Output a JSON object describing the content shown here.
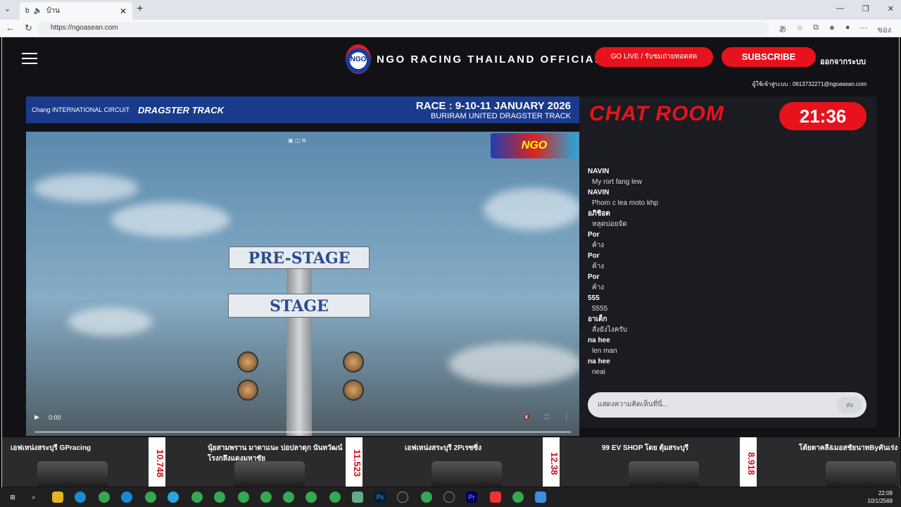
{
  "browser": {
    "tab_title": "บ้าน",
    "url": "https://ngoasean.com",
    "profile_label": "ของ"
  },
  "header": {
    "brand_title": "NGO RACING THAILAND OFFICIAL",
    "logo_text": "NGO",
    "go_live_label": "GO LIVE / รับชมถ่ายทอดสด",
    "subscribe_label": "SUBSCRIBE",
    "logout_label": "ออกจากระบบ",
    "contact": "ผู้ใช้เข้าสู่ระบบ : 0613732271@ngoasean.com"
  },
  "video": {
    "banner_left": "Chang INTERNATIONAL CIRCUIT",
    "banner_track": "DRAGSTER TRACK",
    "race_title": "RACE : 9-10-11 JANUARY 2026",
    "race_subtitle": "BURIRAM UNITED DRAGSTER TRACK",
    "sign_top": "PRE-STAGE",
    "sign_bottom": "STAGE",
    "badge_text": "NGO",
    "time": "0:00"
  },
  "chat": {
    "title": "CHAT ROOM",
    "timer": "21:36",
    "messages": [
      {
        "name": "NAVIN",
        "text": "My rort fang lew"
      },
      {
        "name": "NAVIN",
        "text": "Phom c lea moto khp"
      },
      {
        "name": "อภิชิอต",
        "text": "หลุดบ่อยจัด"
      },
      {
        "name": "Por",
        "text": "ค้าง"
      },
      {
        "name": "Por",
        "text": "ค้าง"
      },
      {
        "name": "Por",
        "text": "ค้าง"
      },
      {
        "name": "555",
        "text": "5555"
      },
      {
        "name": "อาเต็ก",
        "text": "สั่งยังไงครับ"
      },
      {
        "name": "na hee",
        "text": "len man"
      },
      {
        "name": "na hee",
        "text": "neai"
      }
    ],
    "input_placeholder": "แสดงความคิดเห็นที่นี่...",
    "send_label": "ส่ง"
  },
  "ticker": [
    {
      "name": "เอฟเหน่งสระบุรี GPracing",
      "time": "10.748"
    },
    {
      "name": "นุ้ยสามพราน มาดาแนะ บ่อปลาดุก นันทวัฒน์ โรงกลึงแดงมหาชัย",
      "time": "11.523"
    },
    {
      "name": "เอฟเหน่งสระบุรี 2Pเรซซิ่ง",
      "time": "12.38"
    },
    {
      "name": "99 EV SHOP โดย ตุ้มสระบุรี",
      "time": "8.918"
    },
    {
      "name": "โต้ยตาคลี&มอสชัยนาทByคันเร่ง",
      "time": ""
    }
  ],
  "taskbar": {
    "time": "22:09",
    "date": "10/1/2569"
  }
}
